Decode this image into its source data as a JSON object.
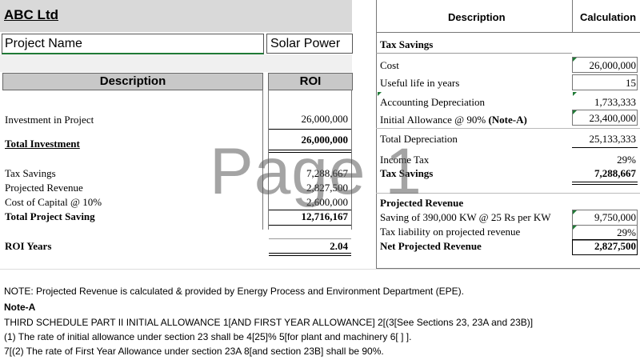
{
  "company": "ABC Ltd",
  "project": {
    "label": "Project Name",
    "value": "Solar Power"
  },
  "left_table": {
    "headers": {
      "description": "Description",
      "roi": "ROI"
    },
    "investment_label": "Investment in Project",
    "investment_value": "26,000,000",
    "total_investment_label": "Total Investment",
    "total_investment_value": "26,000,000",
    "tax_savings_label": "Tax Savings",
    "tax_savings_value": "7,288,667",
    "projected_revenue_label": "Projected Revenue",
    "projected_revenue_value": "2,827,500",
    "cost_of_capital_label": "Cost of Capital @ 10%",
    "cost_of_capital_value": "2,600,000",
    "total_saving_label": "Total Project Saving",
    "total_saving_value": "12,716,167",
    "roi_years_label": "ROI Years",
    "roi_years_value": "2.04"
  },
  "right_table": {
    "headers": {
      "description": "Description",
      "calculation": "Calculation"
    },
    "tax_section_title": "Tax Savings",
    "cost_label": "Cost",
    "cost_value": "26,000,000",
    "life_label": "Useful life in years",
    "life_value": "15",
    "acc_dep_label": "Accounting Depreciation",
    "acc_dep_value": "1,733,333",
    "init_allow_label": "Initial Allowance @ 90%",
    "init_allow_note": "(Note-A)",
    "init_allow_value": "23,400,000",
    "total_dep_label": "Total Depreciation",
    "total_dep_value": "25,133,333",
    "income_tax_label": "Income Tax",
    "income_tax_value": "29%",
    "tax_savings_label": "Tax Savings",
    "tax_savings_value": "7,288,667",
    "revenue_section_title": "Projected Revenue",
    "saving_label": "Saving of 390,000 KW @ 25 Rs per KW",
    "saving_value": "9,750,000",
    "tax_liab_label": "Tax liability on projected revenue",
    "tax_liab_value": "29%",
    "net_rev_label": "Net Projected Revenue",
    "net_rev_value": "2,827,500"
  },
  "notes": {
    "note1": "NOTE: Projected Revenue is calculated & provided by Energy Process and Environment Department (EPE).",
    "note_a_title": "Note-A",
    "line1": "THIRD SCHEDULE PART II INITIAL ALLOWANCE 1[AND FIRST YEAR ALLOWANCE] 2[(3[See Sections 23,  23A and 23B)]",
    "line2": "(1) The rate of initial allowance under section 23 shall be 4[25]% 5[for plant and machinery 6[  ] ].",
    "line3": "7[(2)  The rate of First Year Allowance under section 23A 8[and section 23B] shall be 90%."
  },
  "watermark": "Page 1",
  "colors": {
    "header_gray": "#c8c8c8",
    "band_gray": "#d9d9d9",
    "cell_marker_green": "#1f7a36"
  }
}
